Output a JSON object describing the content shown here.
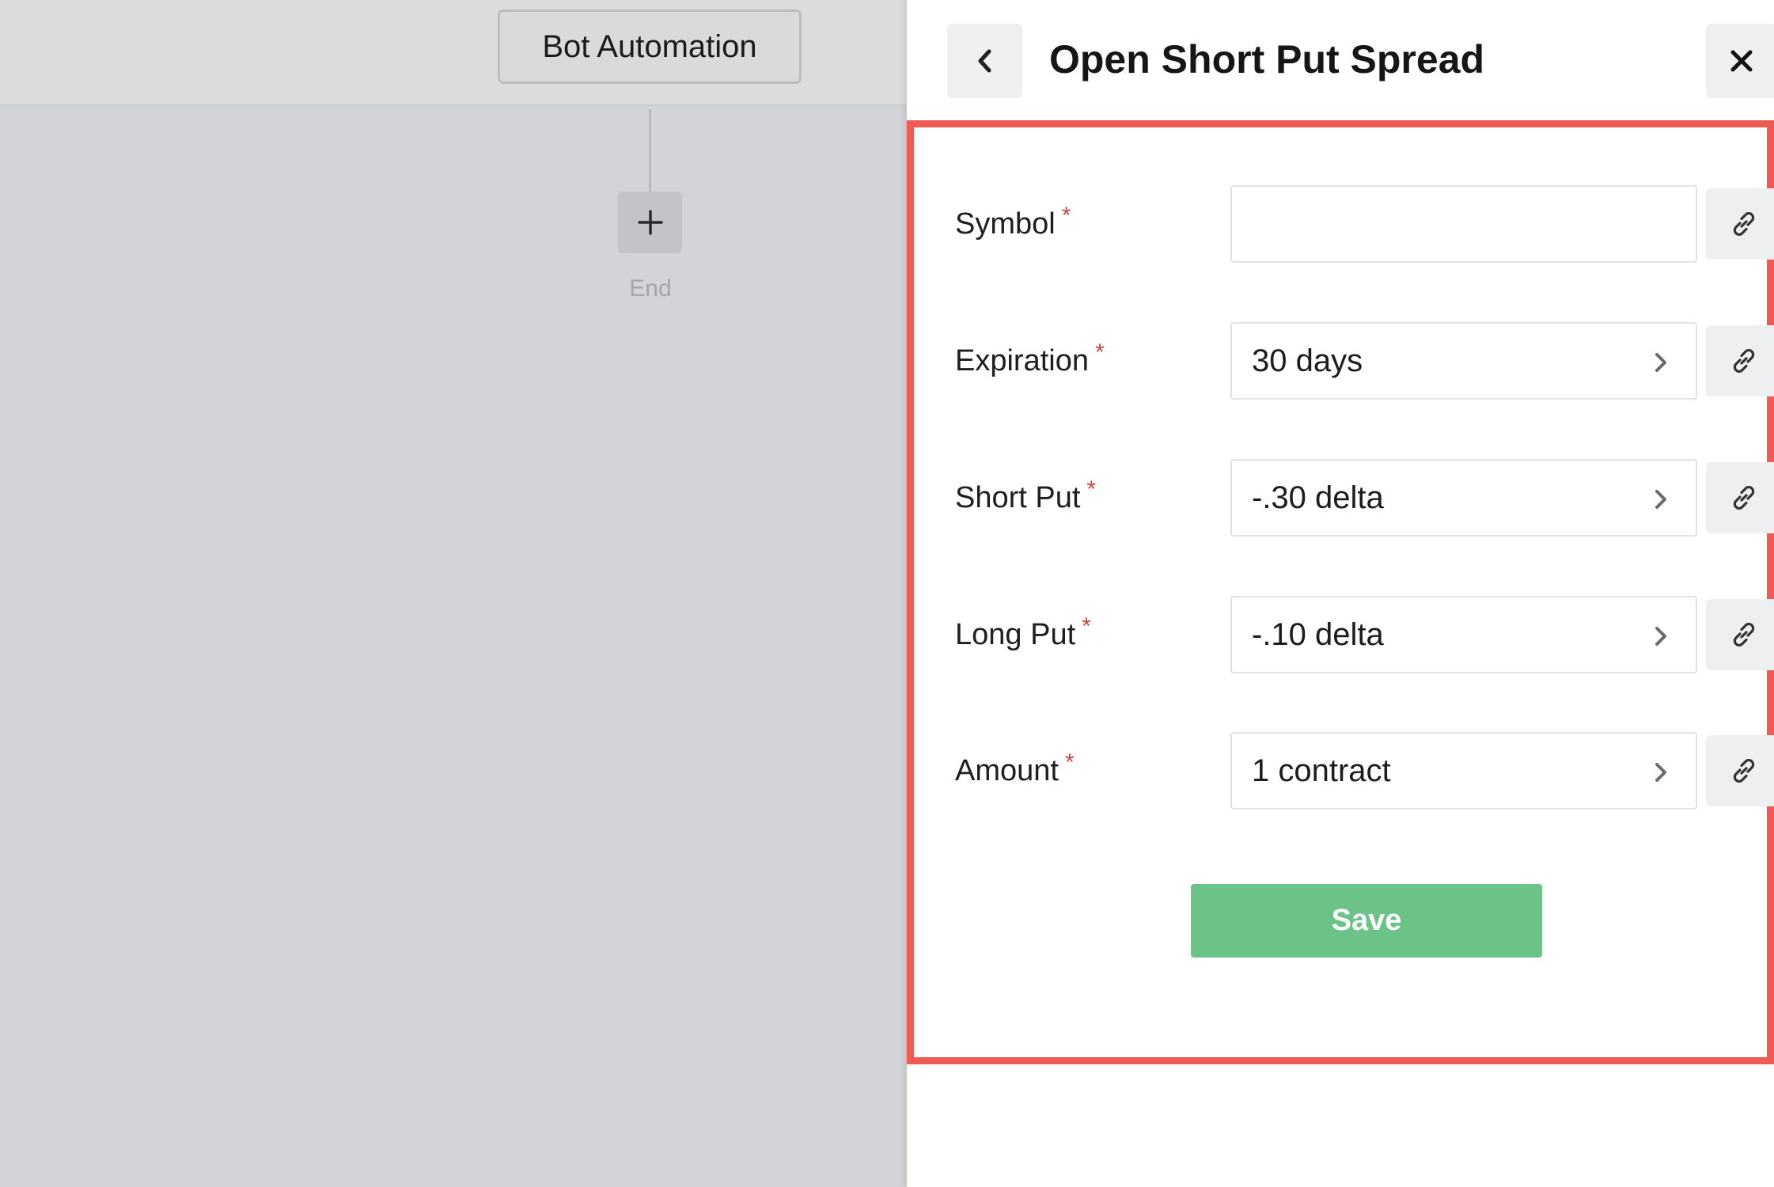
{
  "canvas": {
    "node_title": "Bot Automation",
    "end_label": "End"
  },
  "panel": {
    "title": "Open Short Put Spread",
    "fields": [
      {
        "label": "Symbol",
        "required_mark": "*",
        "value": ""
      },
      {
        "label": "Expiration",
        "required_mark": "*",
        "value": "30 days"
      },
      {
        "label": "Short Put",
        "required_mark": "*",
        "value": "-.30 delta"
      },
      {
        "label": "Long Put",
        "required_mark": "*",
        "value": "-.10 delta"
      },
      {
        "label": "Amount",
        "required_mark": "*",
        "value": "1 contract"
      }
    ],
    "save_label": "Save"
  },
  "icons": {
    "back": "chevron-left-icon",
    "close": "close-icon",
    "add": "plus-icon",
    "field_link": "link-icon",
    "field_open": "chevron-right-icon"
  },
  "colors": {
    "highlight_border": "#ef5a52",
    "save_button": "#6bc388",
    "required_asterisk": "#c94a42"
  }
}
